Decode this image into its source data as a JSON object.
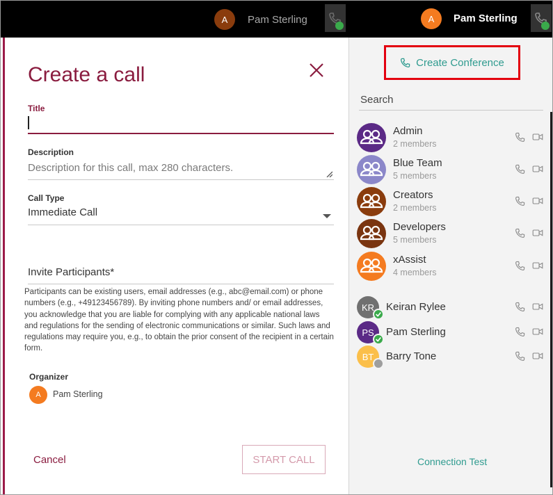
{
  "left_header": {
    "avatar_initial": "A",
    "user_name": "Pam Sterling",
    "avatar_color": "#8a3c0d",
    "name_color": "#a8a8a8"
  },
  "right_header": {
    "avatar_initial": "A",
    "user_name": "Pam Sterling",
    "avatar_color": "#f47b20",
    "name_color": "#ffffff"
  },
  "dialog": {
    "title": "Create a call",
    "title_field": {
      "label": "Title",
      "value": ""
    },
    "description_field": {
      "label": "Description",
      "placeholder": "Description for this call, max 280 characters."
    },
    "call_type": {
      "label": "Call Type",
      "value": "Immediate Call"
    },
    "invite_label": "Invite Participants*",
    "disclaimer": "Participants can be existing users, email addresses (e.g., abc@email.com) or phone numbers (e.g., +49123456789). By inviting phone numbers and/ or email addresses, you acknowledge that you are liable for complying with any applicable national laws and regulations for the sending of electronic communications or similar. Such laws and regulations may require you, e.g., to obtain the prior consent of the recipient in a certain form.",
    "organizer": {
      "label": "Organizer",
      "avatar_initial": "A",
      "name": "Pam Sterling"
    },
    "cancel_label": "Cancel",
    "start_label": "START CALL"
  },
  "sidebar": {
    "create_conference_label": "Create Conference",
    "search_label": "Search",
    "groups": [
      {
        "name": "Admin",
        "members": "2 members",
        "color": "#5b2a86"
      },
      {
        "name": "Blue Team",
        "members": "5 members",
        "color": "#8b87c9"
      },
      {
        "name": "Creators",
        "members": "2 members",
        "color": "#8a3c0d"
      },
      {
        "name": "Developers",
        "members": "5 members",
        "color": "#7a3510"
      },
      {
        "name": "xAssist",
        "members": "4 members",
        "color": "#f47b20"
      }
    ],
    "users": [
      {
        "initials": "KR",
        "name": "Keiran Rylee",
        "color": "#707070",
        "status": "online"
      },
      {
        "initials": "PS",
        "name": "Pam Sterling",
        "color": "#5b2a86",
        "status": "online"
      },
      {
        "initials": "BT",
        "name": "Barry Tone",
        "color": "#fbbf4a",
        "status": "offline"
      }
    ],
    "connection_test_label": "Connection Test"
  },
  "colors": {
    "brand_primary": "#8a1c3f",
    "accent_teal": "#2f9b8f",
    "highlight_box": "#e3000f",
    "online": "#3aaa4b"
  }
}
